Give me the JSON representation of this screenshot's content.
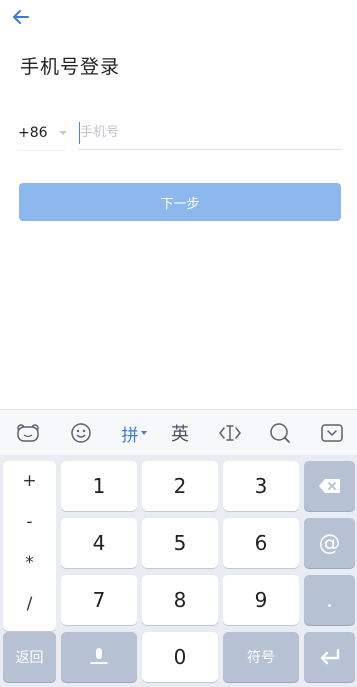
{
  "header": {
    "back_icon": "arrow-left-icon",
    "title": "手机号登录"
  },
  "form": {
    "country_code": "+86",
    "phone_placeholder": "手机号",
    "phone_value": "",
    "next_label": "下一步"
  },
  "keyboard": {
    "toolbar": {
      "logo_icon": "bear-face-icon",
      "emoji_icon": "smiley-icon",
      "pinyin_label": "拼",
      "english_label": "英",
      "cursor_icon": "text-cursor-icon",
      "search_icon": "search-icon",
      "hide_icon": "keyboard-hide-icon"
    },
    "symbols": [
      "+",
      "-",
      "*",
      "/"
    ],
    "digits": [
      "1",
      "2",
      "3",
      "4",
      "5",
      "6",
      "7",
      "8",
      "9",
      "0"
    ],
    "at_label": "@",
    "dot_label": ".",
    "back_label": "返回",
    "symbol_label": "符号",
    "delete_icon": "backspace-icon",
    "mic_icon": "microphone-icon",
    "enter_icon": "enter-icon"
  },
  "colors": {
    "accent": "#3d7bd8",
    "button_disabled": "#8cb8ee",
    "key_dark": "#b6c1d3"
  }
}
